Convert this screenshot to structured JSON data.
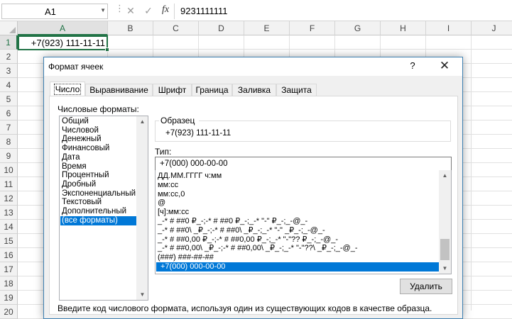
{
  "formula_bar": {
    "name_box": "A1",
    "fx_label": "fx",
    "cancel_glyph": "✕",
    "enter_glyph": "✓",
    "formula_value": "9231111111"
  },
  "sheet": {
    "columns": [
      "A",
      "B",
      "C",
      "D",
      "E",
      "F",
      "G",
      "H",
      "I",
      "J"
    ],
    "rows": [
      "1",
      "2",
      "3",
      "4",
      "5",
      "6",
      "7",
      "8",
      "9",
      "10",
      "11",
      "12",
      "13",
      "14",
      "15",
      "16",
      "17",
      "18",
      "19",
      "20"
    ],
    "active_cell": "A1",
    "cell_a1_display": "+7(923) 111-11-11"
  },
  "dialog": {
    "title": "Формат ячеек",
    "help_glyph": "?",
    "close_glyph": "✕",
    "tabs": [
      "Число",
      "Выравнивание",
      "Шрифт",
      "Граница",
      "Заливка",
      "Защита"
    ],
    "active_tab": "Число",
    "formats_label": "Числовые форматы:",
    "categories": [
      "Общий",
      "Числовой",
      "Денежный",
      "Финансовый",
      "Дата",
      "Время",
      "Процентный",
      "Дробный",
      "Экспоненциальный",
      "Текстовый",
      "Дополнительный",
      "(все форматы)"
    ],
    "selected_category": "(все форматы)",
    "sample_label": "Образец",
    "sample_value": "+7(923) 111-11-11",
    "type_label": "Тип:",
    "type_value": "+7(000) 000-00-00",
    "format_codes": [
      "ДД.ММ.ГГГГ ч:мм",
      "мм:сс",
      "мм:сс,0",
      "@",
      "[ч]:мм:сс",
      "_-* # ##0 ₽_-;-* # ##0 ₽_-;_-* \"-\" ₽_-;_-@_-",
      "_-* # ##0\\ _₽_-;-* # ##0\\ _₽_-;_-* \"-\" _₽_-;_-@_-",
      "_-* # ##0,00 ₽_-;-* # ##0,00 ₽_-;_-* \"-\"?? ₽_-;_-@_-",
      "_-* # ##0,00\\ _₽_-;-* # ##0,00\\ _₽_-;_-* \"-\"??\\ _₽_-;_-@_-",
      "(###) ###-##-##",
      "+7(000) 000-00-00"
    ],
    "selected_format": "+7(000) 000-00-00",
    "delete_button": "Удалить",
    "hint": "Введите код числового формата, используя один из существующих кодов в качестве образца."
  },
  "colors": {
    "accent_green": "#217346",
    "selection_blue": "#0078d7",
    "dialog_border": "#3c7fb1"
  }
}
